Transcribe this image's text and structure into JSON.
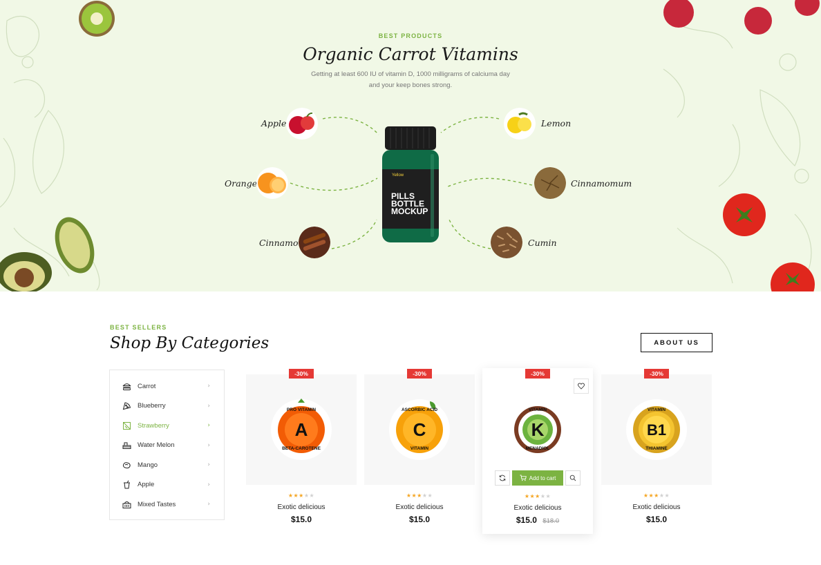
{
  "hero": {
    "eyebrow": "BEST PRODUCTS",
    "title": "Organic Carrot Vitamins",
    "subtitle_line1": "Getting at least 600 IU of vitamin D, 1000 milligrams of calciuma day",
    "subtitle_line2": "and your keep bones strong.",
    "ingredients_left": [
      {
        "label": "Apple",
        "icon": "apple-icon"
      },
      {
        "label": "Orange",
        "icon": "orange-icon"
      },
      {
        "label": "Cinnamon",
        "icon": "cinnamon-icon"
      }
    ],
    "ingredients_right": [
      {
        "label": "Lemon",
        "icon": "lemon-icon"
      },
      {
        "label": "Cinnamomum",
        "icon": "cinnamomum-icon"
      },
      {
        "label": "Cumin",
        "icon": "cumin-icon"
      }
    ],
    "bottle": {
      "brand": "Yellow",
      "line1": "PILLS",
      "line2": "BOTTLE",
      "line3": "MOCKUP"
    },
    "colors": {
      "background": "#f1f8e6",
      "accent": "#7cb342"
    }
  },
  "categories_section": {
    "eyebrow": "BEST SELLERS",
    "title": "Shop By Categories",
    "about_button": "ABOUT US",
    "categories": [
      {
        "label": "Carrot",
        "icon": "burger-icon",
        "active": false
      },
      {
        "label": "Blueberry",
        "icon": "pizza-icon",
        "active": false
      },
      {
        "label": "Strawberry",
        "icon": "leaf-icon",
        "active": true
      },
      {
        "label": "Water Melon",
        "icon": "watermelon-icon",
        "active": false
      },
      {
        "label": "Mango",
        "icon": "mango-icon",
        "active": false
      },
      {
        "label": "Apple",
        "icon": "drink-icon",
        "active": false
      },
      {
        "label": "Mixed Tastes",
        "icon": "basket-icon",
        "active": false
      }
    ],
    "chevron": "›"
  },
  "products": [
    {
      "badge": "-30%",
      "name": "Exotic delicious",
      "price": "$15.0",
      "old_price": "",
      "rating": 3,
      "label_top": "PRO VITAMIN",
      "label_letter": "A",
      "label_bottom": "BETA-CAROTENE"
    },
    {
      "badge": "-30%",
      "name": "Exotic delicious",
      "price": "$15.0",
      "old_price": "",
      "rating": 3,
      "label_top": "ASCORBIC ACID",
      "label_letter": "C",
      "label_bottom": "VITAMIN"
    },
    {
      "badge": "-30%",
      "name": "Exotic delicious",
      "price": "$15.0",
      "old_price": "$18.0",
      "rating": 3,
      "label_top": "VITAMIN",
      "label_letter": "K",
      "label_bottom": "MENADIOL",
      "add_to_cart": "Add to cart"
    },
    {
      "badge": "-30%",
      "name": "Exotic delicious",
      "price": "$15.0",
      "old_price": "",
      "rating": 3,
      "label_top": "VITAMIN",
      "label_letter": "B1",
      "label_bottom": "THIAMINE"
    }
  ],
  "colors": {
    "accent": "#7cb342",
    "sale": "#e53935",
    "star": "#f5a623"
  }
}
